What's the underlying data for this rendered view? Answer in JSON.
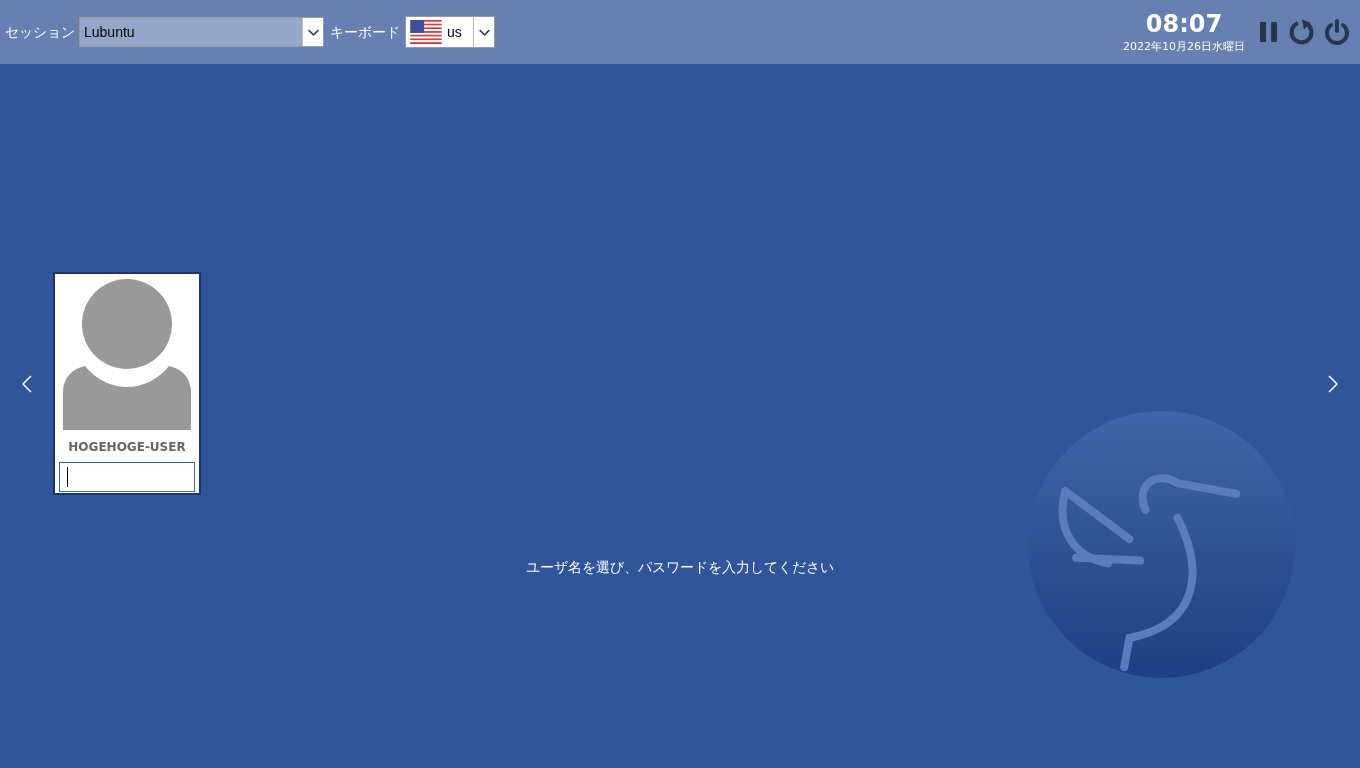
{
  "top_bar": {
    "session": {
      "label": "セッション",
      "value": "Lubuntu"
    },
    "keyboard": {
      "label": "キーボード",
      "value": "us"
    },
    "clock": {
      "time": "08:07",
      "date": "2022年10月26日水曜日"
    }
  },
  "users": [
    {
      "name": "HOGEHOGE-USER",
      "selected": true,
      "password_focused": true
    }
  ],
  "hint": "ユーザ名を選び、パスワードを入力してください"
}
